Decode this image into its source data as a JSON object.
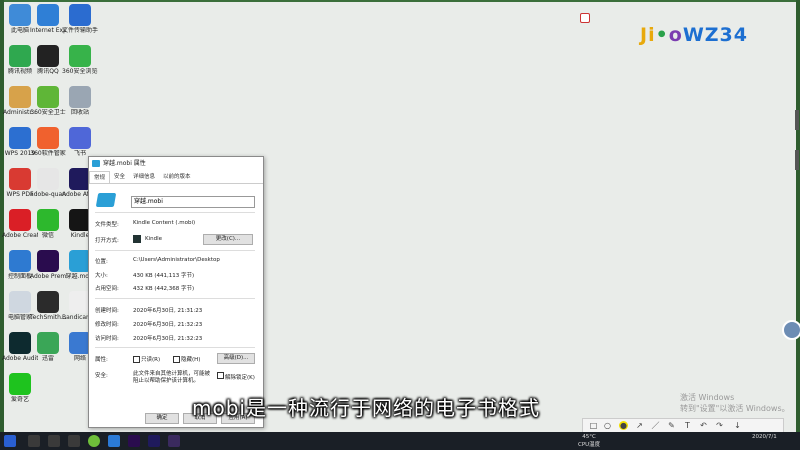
{
  "desktop_icons": [
    {
      "label": "此电脑",
      "color": "#3f8bd8",
      "icon": "computer-icon"
    },
    {
      "label": "Internet Explorer",
      "color": "#2f7fd6",
      "icon": "ie-icon"
    },
    {
      "label": "文件传输助手",
      "color": "#2b6cd0",
      "icon": "file-transfer-icon"
    },
    {
      "label": "腾讯视频",
      "color": "#2fa84f",
      "icon": "tencent-video-icon"
    },
    {
      "label": "腾讯QQ",
      "color": "#222222",
      "icon": "qq-icon"
    },
    {
      "label": "360安全浏览器",
      "color": "#37b34a",
      "icon": "browser-360-icon"
    },
    {
      "label": "Administr...",
      "color": "#d7a24a",
      "icon": "user-folder-icon"
    },
    {
      "label": "360安全卫士",
      "color": "#5fb637",
      "icon": "safeguard-360-icon"
    },
    {
      "label": "回收站",
      "color": "#9aa6b3",
      "icon": "recycle-bin-icon"
    },
    {
      "label": "WPS 2019",
      "color": "#2c6fd1",
      "icon": "wps-icon"
    },
    {
      "label": "360软件管家",
      "color": "#f0612e",
      "icon": "software-manager-icon"
    },
    {
      "label": "飞书",
      "color": "#4f67d8",
      "icon": "feishu-icon"
    },
    {
      "label": "WPS PDF",
      "color": "#d93a32",
      "icon": "wps-pdf-icon"
    },
    {
      "label": "adobe-quan",
      "color": "#e6e6e6",
      "icon": "window-icon"
    },
    {
      "label": "Adobe After Effects",
      "color": "#1f1a5c",
      "icon": "after-effects-icon"
    },
    {
      "label": "Adobe Creati...",
      "color": "#da1f26",
      "icon": "creative-cloud-icon"
    },
    {
      "label": "微信",
      "color": "#2db82d",
      "icon": "wechat-icon"
    },
    {
      "label": "Kindle",
      "color": "#151515",
      "icon": "kindle-icon"
    },
    {
      "label": "控制面板",
      "color": "#2e7ad1",
      "icon": "control-panel-icon"
    },
    {
      "label": "Adobe Premiere Pr...",
      "color": "#2a0c4e",
      "icon": "premiere-icon"
    },
    {
      "label": "穿越.mobi",
      "color": "#2a9fd6",
      "icon": "mobi-book-icon"
    },
    {
      "label": "电脑管家",
      "color": "#cfd7e0",
      "icon": "pc-manager-icon"
    },
    {
      "label": "TechSmith...",
      "color": "#2b2b2b",
      "icon": "techsmith-icon"
    },
    {
      "label": "Bandicam 2020 64",
      "color": "#eeeeee",
      "icon": "bandicam-icon"
    },
    {
      "label": "Adobe Audition ...",
      "color": "#0d2a2f",
      "icon": "audition-icon"
    },
    {
      "label": "迅雷",
      "color": "#3aa657",
      "icon": "xunlei-icon"
    },
    {
      "label": "网络",
      "color": "#3a79d1",
      "icon": "network-icon"
    },
    {
      "label": "爱奇艺",
      "color": "#1ec31e",
      "icon": "iqiyi-icon"
    }
  ],
  "logo": {
    "part1": "Ji",
    "part2": "•",
    "part3": "o",
    "part4": "WZ34"
  },
  "dialog": {
    "title": "穿越.mobi 属性",
    "tabs": [
      "常规",
      "安全",
      "详细信息",
      "以前的版本"
    ],
    "filename": "穿越.mobi",
    "rows": [
      {
        "label": "文件类型:",
        "value": "Kindle Content (.mobi)"
      },
      {
        "label": "打开方式:",
        "value": "Kindle"
      },
      {
        "label": "位置:",
        "value": "C:\\Users\\Administrator\\Desktop"
      },
      {
        "label": "大小:",
        "value": "430 KB (441,113 字节)"
      },
      {
        "label": "占用空间:",
        "value": "432 KB (442,368 字节)"
      },
      {
        "label": "创建时间:",
        "value": "2020年6月30日, 21:31:23"
      },
      {
        "label": "修改时间:",
        "value": "2020年6月30日, 21:32:23"
      },
      {
        "label": "访问时间:",
        "value": "2020年6月30日, 21:32:23"
      },
      {
        "label": "属性:",
        "value": ""
      },
      {
        "label": "安全:",
        "value": "此文件来自其他计算机，可能被阻止以帮助保护该计算机。"
      }
    ],
    "change_button": "更改(C)...",
    "advanced_button": "高级(D)...",
    "readonly_label": "只读(R)",
    "hidden_label": "隐藏(H)",
    "unblock_label": "解除锁定(K)",
    "ok_button": "确定",
    "cancel_button": "取消",
    "apply_button": "应用(A)"
  },
  "subtitle": "mobi是一种流行于网络的电子书格式",
  "watermark": {
    "line1": "激活 Windows",
    "line2": "转到\"设置\"以激活 Windows。"
  },
  "toolbar_icons": [
    "rectangle-icon",
    "circle-icon",
    "highlight-icon",
    "arrow-icon",
    "pen-icon",
    "marker-icon",
    "text-icon",
    "undo-icon",
    "redo-icon",
    "download-icon"
  ],
  "taskbar": {
    "weather": "45°C",
    "cpu": "CPU温度",
    "time": "2020/7/1"
  }
}
